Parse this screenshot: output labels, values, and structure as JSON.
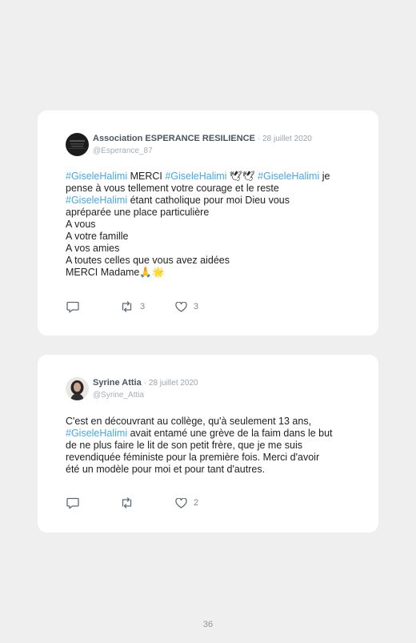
{
  "tweets": [
    {
      "author": "Association ESPERANCE RESILIENCE",
      "date": "· 28 juillet 2020",
      "handle": "@Esperance_87",
      "lines": [
        [
          {
            "t": "tag",
            "v": "#GiseleHalimi"
          },
          {
            "t": "txt",
            "v": " MERCI "
          },
          {
            "t": "tag",
            "v": "#GiseleHalimi"
          },
          {
            "t": "txt",
            "v": " 🕊🕊 "
          },
          {
            "t": "tag",
            "v": "#GiseleHalimi"
          },
          {
            "t": "txt",
            "v": " je"
          }
        ],
        [
          {
            "t": "txt",
            "v": "pense à vous tellement votre courage et le reste"
          }
        ],
        [
          {
            "t": "tag",
            "v": "#GiseleHalimi"
          },
          {
            "t": "txt",
            "v": " étant catholique pour moi Dieu vous"
          }
        ],
        [
          {
            "t": "txt",
            "v": "apréparée une place particulière"
          }
        ],
        [
          {
            "t": "txt",
            "v": "A vous"
          }
        ],
        [
          {
            "t": "txt",
            "v": "A votre famille"
          }
        ],
        [
          {
            "t": "txt",
            "v": "A vos amies"
          }
        ],
        [
          {
            "t": "txt",
            "v": "A toutes celles que vous avez aidées"
          }
        ],
        [
          {
            "t": "txt",
            "v": "MERCI Madame🙏🌟"
          }
        ]
      ],
      "retweets": "3",
      "likes": "3"
    },
    {
      "author": "Syrine Attia",
      "date": "· 28 juillet 2020",
      "handle": "@Syrine_Attia",
      "lines": [
        [
          {
            "t": "txt",
            "v": "C'est en découvrant au collège, qu'à seulement 13 ans,"
          }
        ],
        [
          {
            "t": "tag",
            "v": "#GiseleHalimi"
          },
          {
            "t": "txt",
            "v": " avait entamé une grève de la faim dans le but"
          }
        ],
        [
          {
            "t": "txt",
            "v": "de ne plus faire le lit de son petit frère, que je me suis"
          }
        ],
        [
          {
            "t": "txt",
            "v": "revendiquée féministe pour la première fois. Merci d'avoir"
          }
        ],
        [
          {
            "t": "txt",
            "v": "été un modèle pour moi et pour tant d'autres."
          }
        ]
      ],
      "retweets": "",
      "likes": "2"
    }
  ],
  "icons": {
    "reply": "reply-icon",
    "retweet": "retweet-icon",
    "like": "heart-icon"
  },
  "colors": {
    "hashtag": "#45a8e6",
    "name": "#4a5561",
    "meta": "#9aa4ad",
    "background": "#efefef",
    "card": "#ffffff"
  },
  "page_number": "36"
}
